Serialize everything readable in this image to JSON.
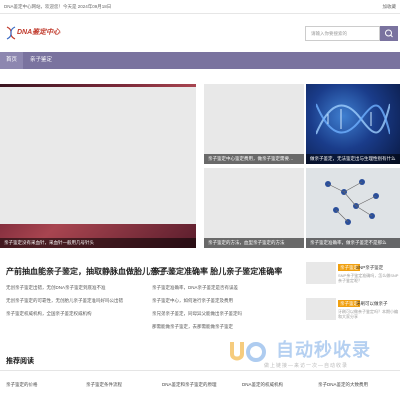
{
  "topbar": {
    "welcome": "DNA鉴定中心网站，欢迎您！今天是 2024年09月18日",
    "favorite": "加收藏"
  },
  "header": {
    "logo_text": "DNA鉴定中心",
    "search_placeholder": "请输入你要搜索的"
  },
  "nav": {
    "items": [
      "首页",
      "亲子鉴定"
    ]
  },
  "featured": {
    "main_caption": "亲子鉴定没有采血针，采血针一般用几号针头",
    "mid_top_caption": "亲子鉴定中心鉴定费用，做亲子鉴定需要…",
    "mid_bot_caption": "亲子鉴定的方法，血型亲子鉴定的方法",
    "right_top_caption": "做亲子鉴定，无法鉴定出与生理性别有什么",
    "right_bot_caption": "亲子鉴定准确率，做亲子鉴定不是那么"
  },
  "section_left": {
    "title": "产前抽血能亲子鉴定，抽取静脉血做胎儿亲子…",
    "items": [
      "无创亲子鉴定出错，无创DNA亲子鉴定到底准不准",
      "无创亲子鉴定的可靠性，无创胎儿亲子鉴定准吗好吗公出错",
      "亲子鉴定权威机构，全国亲子鉴定权威机构"
    ]
  },
  "section_mid": {
    "title": "亲子鉴定准确率 胎儿亲子鉴定准确率",
    "items": [
      "亲子鉴定准确率，DNA亲子鉴定是否有误差",
      "亲子鉴定中心，如何进行亲子鉴定及费用",
      "亲兄弟亲子鉴定，同母异父能做出亲子鉴定吗",
      "那需能做亲子鉴定，去那需能做亲子鉴定"
    ]
  },
  "right_list": [
    {
      "tag": "亲子鉴定",
      "title": "SNP亲子鉴定",
      "desc": "SNP亲子鉴定准确吗，怎么做SNP亲子鉴定呢？"
    },
    {
      "tag": "亲子鉴定",
      "title": "牙刷可以做亲子",
      "desc": "牙刷可以做亲子鉴定吗？本期小编和大家分享"
    }
  ],
  "recommend": {
    "title": "推荐阅读",
    "links": [
      "亲子鉴定的价格",
      "亲子鉴定条件流程",
      "DNA鉴定和亲子鉴定的原理",
      "DNA鉴定的权威机构",
      "亲子DNA鉴定的大致费用"
    ]
  },
  "watermark": {
    "text": "自动秒收录",
    "sub": "做上链接—来访一次—自动收录"
  }
}
